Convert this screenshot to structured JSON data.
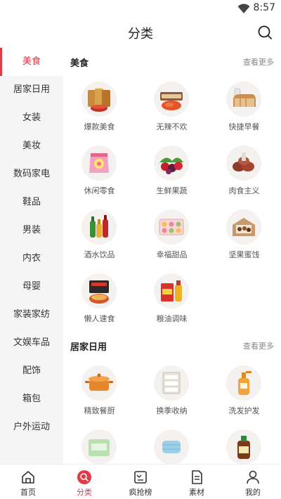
{
  "status_bar": {
    "time": "8:57"
  },
  "header": {
    "title": "分类"
  },
  "sidebar": {
    "items": [
      {
        "label": "美食",
        "active": true
      },
      {
        "label": "居家日用"
      },
      {
        "label": "女装"
      },
      {
        "label": "美妆"
      },
      {
        "label": "数码家电"
      },
      {
        "label": "鞋品"
      },
      {
        "label": "男装"
      },
      {
        "label": "内衣"
      },
      {
        "label": "母婴"
      },
      {
        "label": "家装家纺"
      },
      {
        "label": "文娱车品"
      },
      {
        "label": "配饰"
      },
      {
        "label": "箱包"
      },
      {
        "label": "户外运动"
      }
    ]
  },
  "sections": [
    {
      "title": "美食",
      "more": "查看更多",
      "items": [
        {
          "label": "爆款美食",
          "icon": "snack-bags-image"
        },
        {
          "label": "无辣不欢",
          "icon": "spicy-food-image"
        },
        {
          "label": "快捷早餐",
          "icon": "bread-image"
        },
        {
          "label": "休闲零食",
          "icon": "candy-bag-image"
        },
        {
          "label": "生鲜果蔬",
          "icon": "fruit-image"
        },
        {
          "label": "肉食主义",
          "icon": "meat-image"
        },
        {
          "label": "酒水饮品",
          "icon": "bottles-image"
        },
        {
          "label": "幸福甜品",
          "icon": "dessert-image"
        },
        {
          "label": "坚果蜜饯",
          "icon": "nuts-image"
        },
        {
          "label": "懒人速食",
          "icon": "instant-noodle-image"
        },
        {
          "label": "粮油调味",
          "icon": "rice-oil-image"
        }
      ]
    },
    {
      "title": "居家日用",
      "more": "查看更多",
      "items": [
        {
          "label": "精致餐厨",
          "icon": "cooking-pot-image"
        },
        {
          "label": "换季收纳",
          "icon": "storage-drawer-image"
        },
        {
          "label": "洗发护发",
          "icon": "shampoo-bottle-image"
        },
        {
          "label": "",
          "icon": "tissue-pack-image"
        },
        {
          "label": "",
          "icon": "face-mask-image"
        },
        {
          "label": "",
          "icon": "disinfectant-bottle-image"
        }
      ]
    }
  ],
  "tabbar": {
    "tabs": [
      {
        "label": "首页",
        "icon": "home-icon"
      },
      {
        "label": "分类",
        "icon": "category-search-icon",
        "active": true
      },
      {
        "label": "疯抢榜",
        "icon": "ranking-icon"
      },
      {
        "label": "素材",
        "icon": "material-doc-icon"
      },
      {
        "label": "我的",
        "icon": "profile-icon"
      }
    ]
  },
  "colors": {
    "accent": "#e23b46",
    "sidebar_bg": "#f5f5f5",
    "thumb_bg": "#f4f1ee"
  }
}
